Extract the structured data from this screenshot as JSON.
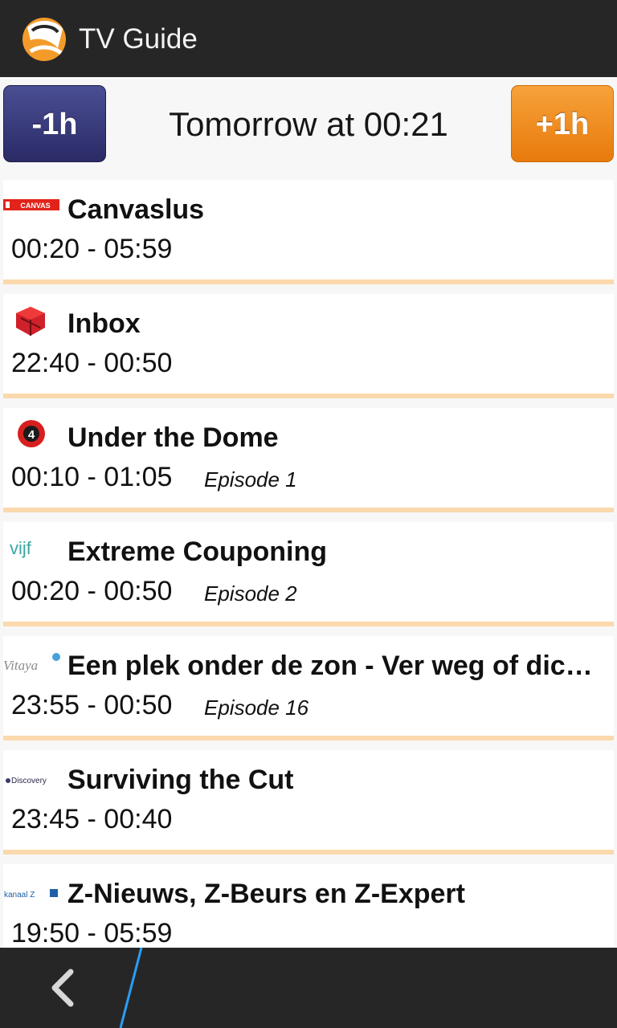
{
  "app": {
    "title": "TV Guide"
  },
  "timebar": {
    "minus_label": "-1h",
    "time_label": "Tomorrow at 00:21",
    "plus_label": "+1h"
  },
  "colors": {
    "minus": "#2e2f6c",
    "plus": "#ef8a1a",
    "separator": "#fbd9ad",
    "nav_accent": "#2a9df4"
  },
  "programs": [
    {
      "channel": "CANVAS",
      "channel_icon": "canvas-logo",
      "title": "Canvaslus",
      "time": "00:20 - 05:59",
      "episode": ""
    },
    {
      "channel": "",
      "channel_icon": "red-cube-logo",
      "title": "Inbox",
      "time": "22:40 - 00:50",
      "episode": ""
    },
    {
      "channel": "",
      "channel_icon": "red-circle-4-logo",
      "title": "Under the Dome",
      "time": "00:10 - 01:05",
      "episode": "Episode 1"
    },
    {
      "channel": "vijf",
      "channel_icon": "vijf-logo",
      "title": "Extreme Couponing",
      "time": "00:20 - 00:50",
      "episode": "Episode 2"
    },
    {
      "channel": "Vitaya",
      "channel_icon": "vitaya-logo",
      "title": "Een plek onder de zon - Ver weg of dichtbij",
      "time": "23:55 - 00:50",
      "episode": "Episode 16"
    },
    {
      "channel": "Discovery",
      "channel_icon": "discovery-logo",
      "title": "Surviving the Cut",
      "time": "23:45 - 00:40",
      "episode": ""
    },
    {
      "channel": "kanaal Z",
      "channel_icon": "kanaal-z-logo",
      "title": "Z-Nieuws, Z-Beurs en Z-Expert",
      "time": "19:50 - 05:59",
      "episode": ""
    }
  ],
  "navbar": {
    "back_icon": "back-chevron-icon"
  }
}
